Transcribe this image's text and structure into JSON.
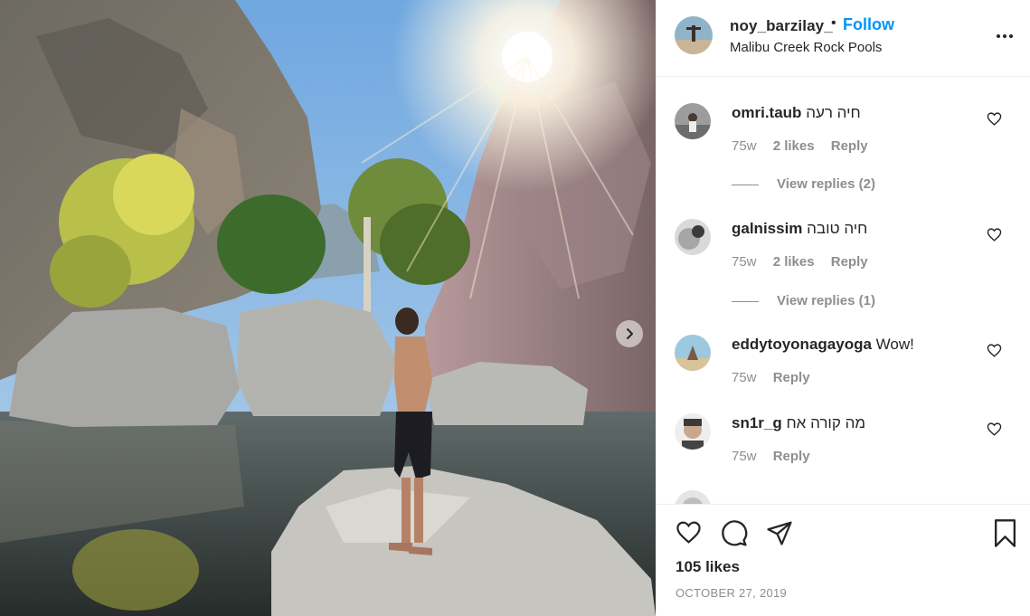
{
  "post": {
    "username": "noy_barzilay_",
    "dot": "•",
    "follow_label": "Follow",
    "location": "Malibu Creek Rock Pools"
  },
  "icons": {
    "more": "more-options-icon",
    "next": "chevron-right-icon",
    "like": "heart-icon",
    "comment": "comment-bubble-icon",
    "share": "paper-plane-icon",
    "save": "bookmark-icon"
  },
  "colors": {
    "accent": "#0095f6",
    "text": "#262626",
    "muted": "#8e8e8e",
    "divider": "#efefef"
  },
  "comments": [
    {
      "user": "omri.taub",
      "text": "חיה רעה",
      "time": "75w",
      "likes": "2 likes",
      "reply": "Reply",
      "view_replies": "View replies (2)"
    },
    {
      "user": "galnissim",
      "text": "חיה טובה",
      "time": "75w",
      "likes": "2 likes",
      "reply": "Reply",
      "view_replies": "View replies (1)"
    },
    {
      "user": "eddytoyonagayoga",
      "text": "Wow!",
      "time": "75w",
      "likes": "",
      "reply": "Reply",
      "view_replies": ""
    },
    {
      "user": "sn1r_g",
      "text": "מה קורה אח",
      "time": "75w",
      "likes": "",
      "reply": "Reply",
      "view_replies": ""
    }
  ],
  "footer": {
    "likes": "105 likes",
    "date": "OCTOBER 27, 2019"
  }
}
